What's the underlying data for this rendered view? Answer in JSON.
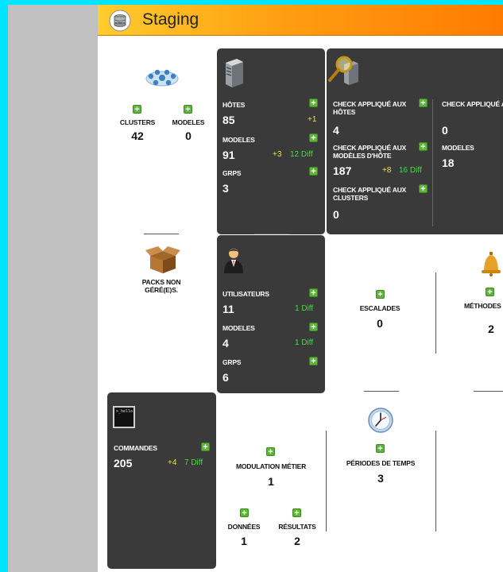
{
  "header": {
    "title": "Staging"
  },
  "top_left": {
    "clusters": {
      "label": "CLUSTERS",
      "value": "42"
    },
    "modeles": {
      "label": "MODELES",
      "value": "0"
    }
  },
  "hosts_tile": {
    "hotes": {
      "label": "HÔTES",
      "value": "85",
      "delta": "+1"
    },
    "modeles": {
      "label": "MODELES",
      "value": "91",
      "delta": "+3",
      "diff": "12 Diff"
    },
    "grps": {
      "label": "GRPS",
      "value": "3"
    }
  },
  "checks_tile": {
    "hotes": {
      "label": "CHECK APPLIQUÉ AUX HÔTES",
      "value": "4"
    },
    "modeles_hote": {
      "label": "CHECK APPLIQUÉ AUX MODÈLES D'HÔTE",
      "value": "187",
      "delta": "+8",
      "diff": "16 Diff"
    },
    "clusters": {
      "label": "CHECK APPLIQUÉ AUX CLUSTERS",
      "value": "0"
    },
    "modeles_clusters": {
      "label": "CHECK APPLIQUÉ AUX MODÈLES DE CLUSTERS",
      "value": "0"
    },
    "modeles": {
      "label": "MODELES",
      "value": "18"
    }
  },
  "packs": {
    "label": "PACKS NON GÉRÉ(E)S."
  },
  "users_tile": {
    "utilisateurs": {
      "label": "UTILISATEURS",
      "value": "11",
      "diff": "1 Diff"
    },
    "modeles": {
      "label": "MODELES",
      "value": "4",
      "diff": "1 Diff"
    },
    "grps": {
      "label": "GRPS",
      "value": "6"
    }
  },
  "escalades": {
    "label": "ESCALADES",
    "value": "0"
  },
  "notifications": {
    "label": "MÉTHODES DE NOTIFICATION",
    "value": "2"
  },
  "commands_tile": {
    "icon_text": ">_hello",
    "commandes": {
      "label": "COMMANDES",
      "value": "205",
      "delta": "+4",
      "diff": "7 Diff"
    }
  },
  "modulation": {
    "label": "MODULATION MÉTIER",
    "value": "1"
  },
  "donnees": {
    "label": "DONNÉES",
    "value": "1"
  },
  "resultats": {
    "label": "RÉSULTATS",
    "value": "2"
  },
  "periodes": {
    "label": "PÉRIODES DE TEMPS",
    "value": "3"
  }
}
